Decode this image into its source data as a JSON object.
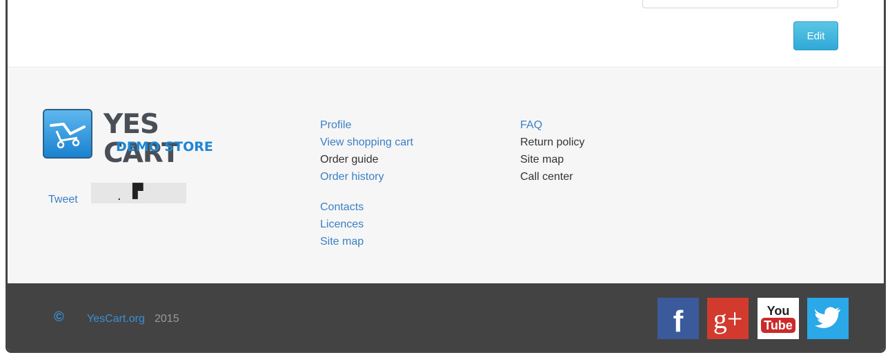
{
  "page": {
    "edit_label": "Edit"
  },
  "footer": {
    "logo": {
      "line1": "YES CART",
      "line2": "DEMO STORE",
      "icon": "shopping-cart-icon"
    },
    "tweet_label": "Tweet",
    "columns": [
      {
        "links": [
          {
            "label": "Profile",
            "link": true
          },
          {
            "label": "View shopping cart",
            "link": true
          },
          {
            "label": "Order guide",
            "link": false
          },
          {
            "label": "Order history",
            "link": true
          }
        ]
      },
      {
        "links": [
          {
            "label": "Contacts",
            "link": true
          },
          {
            "label": "Licences",
            "link": true
          },
          {
            "label": "Site map",
            "link": true
          }
        ]
      },
      {
        "links": [
          {
            "label": "FAQ",
            "link": true
          },
          {
            "label": "Return policy",
            "link": false
          },
          {
            "label": "Site map",
            "link": false
          },
          {
            "label": "Call center",
            "link": false
          }
        ]
      }
    ]
  },
  "bottom_bar": {
    "copyright_symbol": "©",
    "site_link": "YesCart.org",
    "year": "2015",
    "social": [
      {
        "name": "facebook",
        "glyph": "f",
        "color": "#3a5a9c"
      },
      {
        "name": "google-plus",
        "glyph": "g+",
        "color": "#d23a2e"
      },
      {
        "name": "youtube",
        "glyph_top": "You",
        "glyph_bottom": "Tube",
        "color": "#cc2a2a"
      },
      {
        "name": "twitter",
        "icon": "bird-icon",
        "color": "#2aa8e8"
      }
    ]
  }
}
